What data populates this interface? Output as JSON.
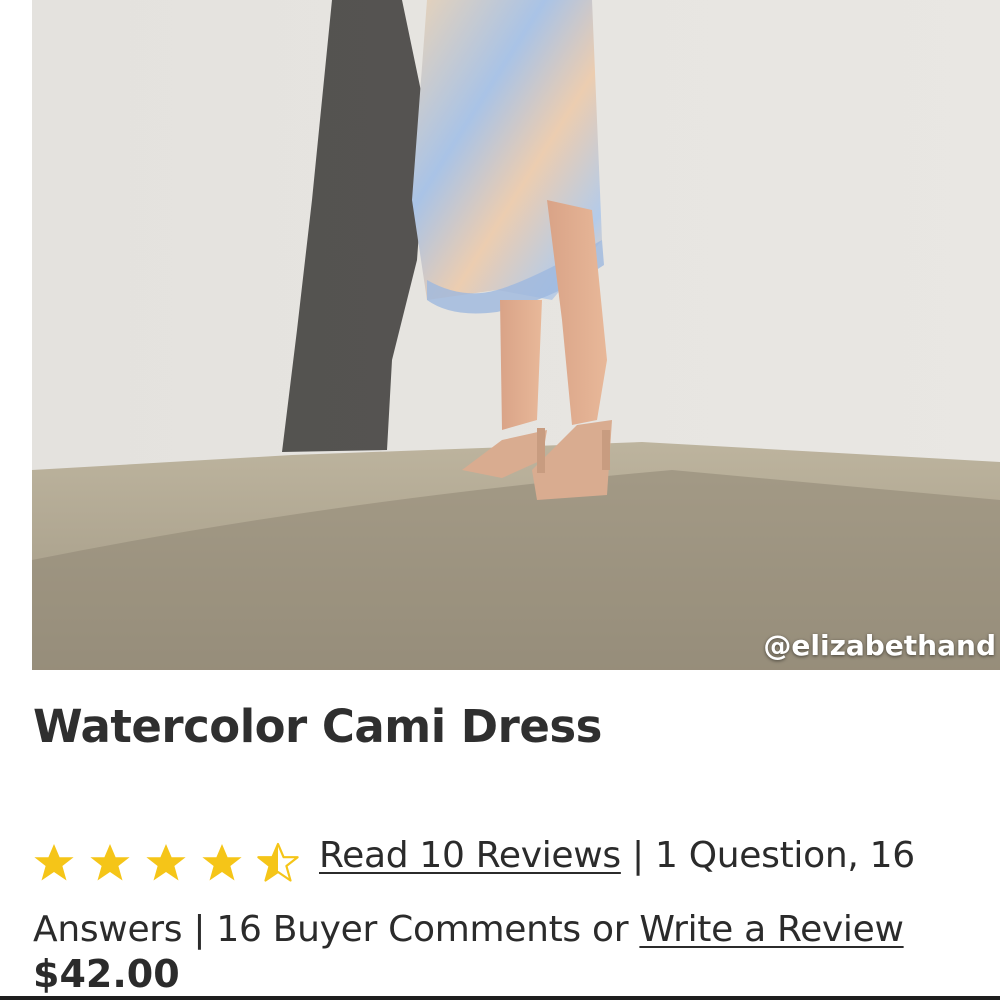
{
  "product": {
    "image_credit": "@elizabethand",
    "title": "Watercolor Cami Dress",
    "price": "$42.00"
  },
  "rating": {
    "value": 4.5,
    "max": 5,
    "star_color": "#f5c518",
    "stars": [
      "star-full-icon",
      "star-full-icon",
      "star-full-icon",
      "star-full-icon",
      "star-half-icon"
    ]
  },
  "reviews": {
    "read_reviews_label": "Read 10 Reviews",
    "sep1": " | ",
    "questions_text": "1 Question, 16 Answers",
    "sep2": " | ",
    "comments_text": "16 Buyer Comments or ",
    "write_review_label": "Write a Review"
  }
}
